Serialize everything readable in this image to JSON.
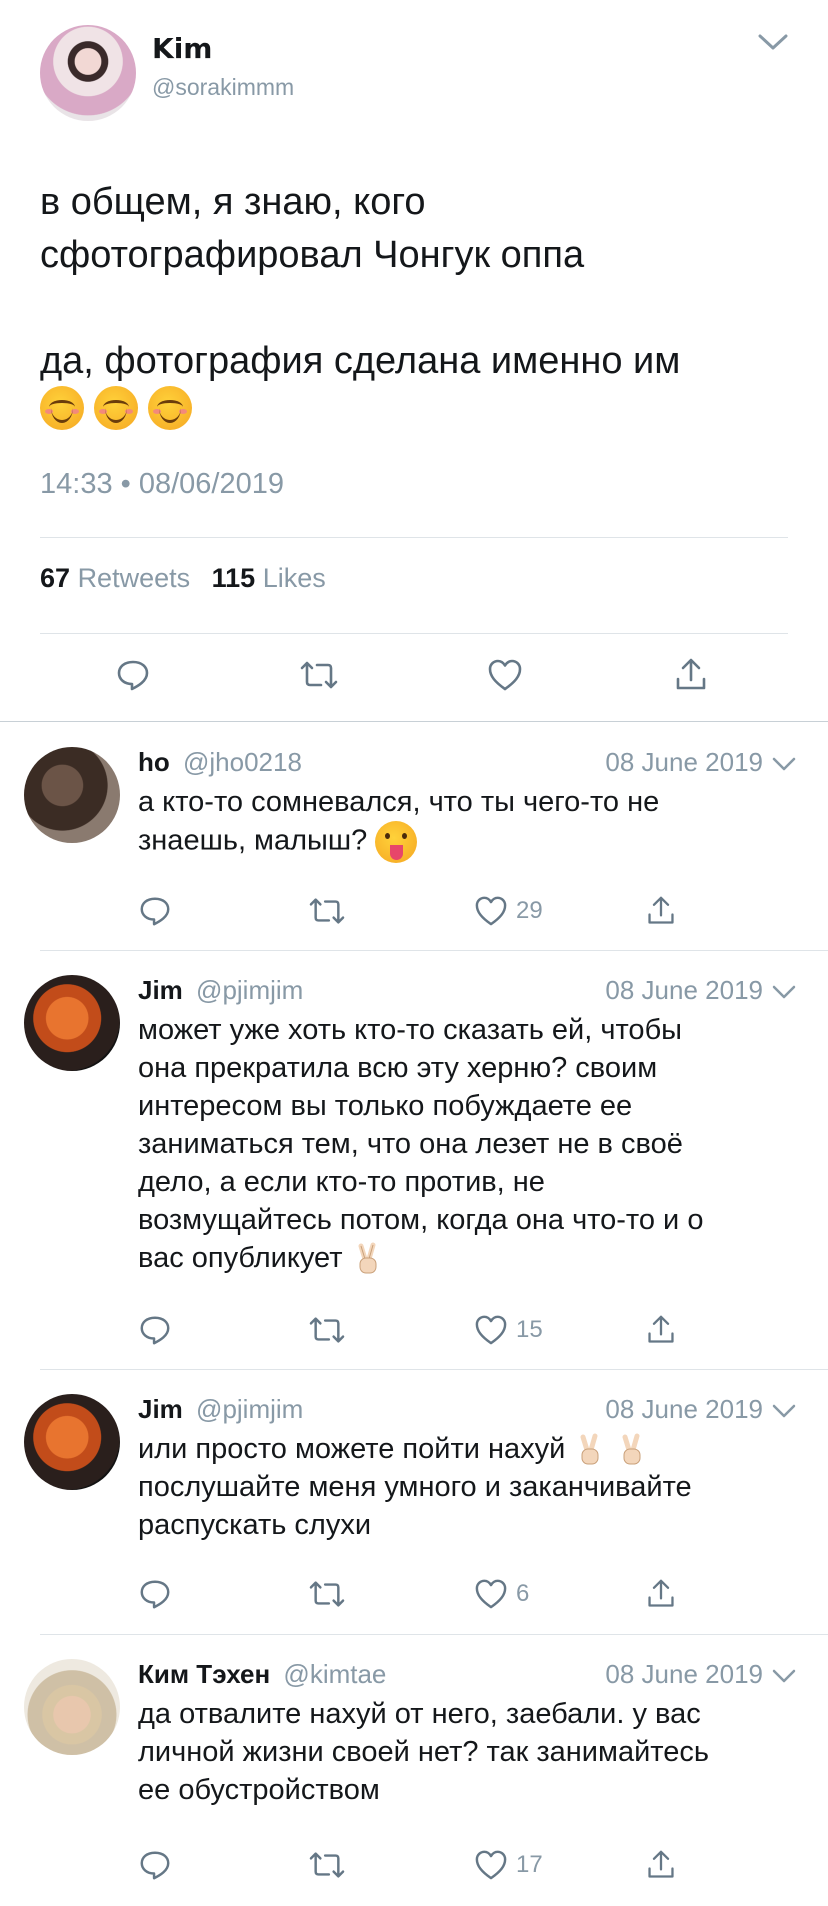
{
  "tweet": {
    "author_name": "Kim",
    "author_handle": "@sorakimmm",
    "text_lines": [
      "в общем, я знаю, кого",
      "сфотографировал Чонгук оппа",
      "",
      "да, фотография сделана именно им"
    ],
    "emoji": [
      "smiling-face-icon",
      "smiling-face-icon",
      "smiling-face-icon"
    ],
    "timestamp": "14:33 • 08/06/2019",
    "retweets_count": "67",
    "retweets_label": "Retweets",
    "likes_count": "115",
    "likes_label": "Likes"
  },
  "replies": [
    {
      "name": "ho",
      "handle": "@jho0218",
      "date": "08 June 2019",
      "lines": [
        "а кто-то сомневался, что ты чего-то не",
        "знаешь, малыш?"
      ],
      "emoji": "tongue-face-icon",
      "like_count": "29"
    },
    {
      "name": "Jim",
      "handle": "@pjimjim",
      "date": "08 June 2019",
      "lines": [
        "может уже хоть кто-то сказать ей, чтобы",
        "она прекратила всю эту херню? своим",
        "интересом вы только побуждаете ее",
        "заниматься тем, что она лезет не в своё",
        "дело, а если кто-то против, не",
        "возмущайтесь потом, когда она что-то и о",
        "вас опубликует"
      ],
      "emoji": "victory-hand-icon",
      "like_count": "15"
    },
    {
      "name": "Jim",
      "handle": "@pjimjim",
      "date": "08 June 2019",
      "lines": [
        "или просто можете пойти нахуй",
        "послушайте меня умного и заканчивайте",
        "распускать слухи"
      ],
      "emoji": "victory-hand-icon",
      "like_count": "6"
    },
    {
      "name": "Ким Тэхен",
      "handle": "@kimtae",
      "date": "08 June 2019",
      "lines": [
        "да отвалите нахуй от него, заебали. у вас",
        "личной жизни своей нет? так занимайтесь",
        "ее обустройством"
      ],
      "like_count": "17"
    }
  ],
  "colors": {
    "text": "#14171a",
    "secondary": "#8899a6",
    "icon": "#657786",
    "divider": "#dfe4e8"
  }
}
